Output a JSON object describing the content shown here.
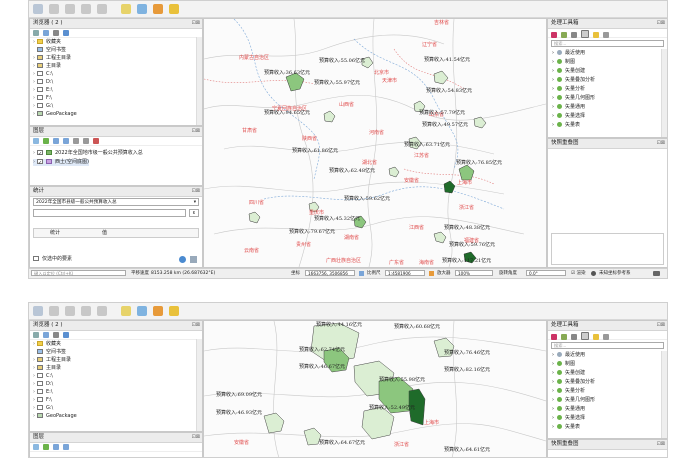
{
  "browser_panel": {
    "title": "浏览器 ( 2 )",
    "items": [
      {
        "label": "收藏夹",
        "icon": "star-icon"
      },
      {
        "label": "空间书签",
        "icon": "bookmark-icon"
      },
      {
        "label": "工程主目录",
        "icon": "folder-icon"
      },
      {
        "label": "主目录",
        "icon": "home-icon"
      },
      {
        "label": "C:\\",
        "icon": "drive-icon"
      },
      {
        "label": "D:\\",
        "icon": "drive-icon"
      },
      {
        "label": "E:\\",
        "icon": "drive-icon"
      },
      {
        "label": "F:\\",
        "icon": "drive-icon"
      },
      {
        "label": "G:\\",
        "icon": "drive-icon"
      },
      {
        "label": "GeoPackage",
        "icon": "geopackage-icon"
      }
    ]
  },
  "layers_panel": {
    "title": "图层",
    "layers": [
      {
        "label": "2022年全国地市级一般公共预算收入总",
        "checked": true
      },
      {
        "label": "西土(空间底图)",
        "checked": true
      }
    ]
  },
  "stats_panel": {
    "title": "统计",
    "layer_select": "2022年全国市县级一般公共预算收入总",
    "col_stat": "统计",
    "col_value": "值",
    "only_selected": "仅选中的要素"
  },
  "search_bar": {
    "placeholder": "键入以定位 (Ctrl+K)"
  },
  "statusbar": {
    "extent_label": "平移速度",
    "extent_value": "8153.258 km (26.687632°E)",
    "coord_label": "坐标",
    "coord_value": "1663756, 3506856",
    "scale_label": "比例尺",
    "scale_value": "1:4581906",
    "magnifier_label": "放大器",
    "magnifier_value": "100%",
    "rotation_label": "旋转角度",
    "rotation_value": "0.0°",
    "render_label": "渲染",
    "crs_label": "未知坐标参考系"
  },
  "toolbox_panel": {
    "title": "处理工具箱",
    "search_placeholder": "搜索...",
    "items": [
      "最近使用",
      "制图",
      "矢量创建",
      "矢量叠加分析",
      "矢量分析",
      "矢量几何图形",
      "矢量通用",
      "矢量选择",
      "矢量表"
    ]
  },
  "snapping_panel": {
    "title": "快照重叠图"
  },
  "map1": {
    "provinces": [
      {
        "name": "吉林省"
      },
      {
        "name": "内蒙古自治区"
      },
      {
        "name": "辽宁省"
      },
      {
        "name": "北京市"
      },
      {
        "name": "天津市"
      },
      {
        "name": "山西省"
      },
      {
        "name": "宁夏回族自治区"
      },
      {
        "name": "山东省"
      },
      {
        "name": "河南省"
      },
      {
        "name": "甘肃省"
      },
      {
        "name": "陕西省"
      },
      {
        "name": "湖北省"
      },
      {
        "name": "江苏省"
      },
      {
        "name": "上海市"
      },
      {
        "name": "安徽省"
      },
      {
        "name": "四川省"
      },
      {
        "name": "浙江省"
      },
      {
        "name": "重庆市"
      },
      {
        "name": "湖南省"
      },
      {
        "name": "江西省"
      },
      {
        "name": "贵州省"
      },
      {
        "name": "福建省"
      },
      {
        "name": "云南省"
      },
      {
        "name": "广西壮族自治区"
      },
      {
        "name": "广东省"
      },
      {
        "name": "海南省"
      }
    ],
    "labels": [
      {
        "name": "预算收入:36.63亿元"
      },
      {
        "name": "预算收入:55.06亿元"
      },
      {
        "name": "预算收入:41.54亿元"
      },
      {
        "name": "预算收入:55.97亿元"
      },
      {
        "name": "预算收入:54.83亿元"
      },
      {
        "name": "预算收入:57.79亿元"
      },
      {
        "name": "预算收入:94.65亿元"
      },
      {
        "name": "预算收入:49.57亿元"
      },
      {
        "name": "预算收入:61.86亿元"
      },
      {
        "name": "预算收入:63.71亿元"
      },
      {
        "name": "预算收入:76.85亿元"
      },
      {
        "name": "预算收入:62.48亿元"
      },
      {
        "name": "预算收入:59.62亿元"
      },
      {
        "name": "预算收入:45.32亿元"
      },
      {
        "name": "预算收入:79.67亿元"
      },
      {
        "name": "预算收入:59.76亿元"
      },
      {
        "name": "预算收入:48.38亿元"
      },
      {
        "name": "预算收入:117.21亿元"
      }
    ]
  },
  "map2": {
    "provinces": [
      {
        "name": "上海市"
      },
      {
        "name": "浙江省"
      },
      {
        "name": "安徽省"
      }
    ],
    "labels": [
      {
        "name": "预算收入:44.16亿元"
      },
      {
        "name": "预算收入:60.68亿元"
      },
      {
        "name": "预算收入:76.46亿元"
      },
      {
        "name": "预算收入:62.74亿元"
      },
      {
        "name": "预算收入:82.16亿元"
      },
      {
        "name": "预算收入:46.67亿元"
      },
      {
        "name": "预算收入:55.98亿元"
      },
      {
        "name": "预算收入:69.09亿元"
      },
      {
        "name": "预算收入:52.49亿元"
      },
      {
        "name": "预算收入:46.93亿元"
      },
      {
        "name": "预算收入:64.67亿元"
      },
      {
        "name": "预算收入:64.61亿元"
      }
    ]
  },
  "colors": {
    "choropleth_light": "#dbeed3",
    "choropleth_mid": "#8cc67e",
    "choropleth_dark": "#1f6b2a",
    "province_label": "#e04a4a"
  }
}
